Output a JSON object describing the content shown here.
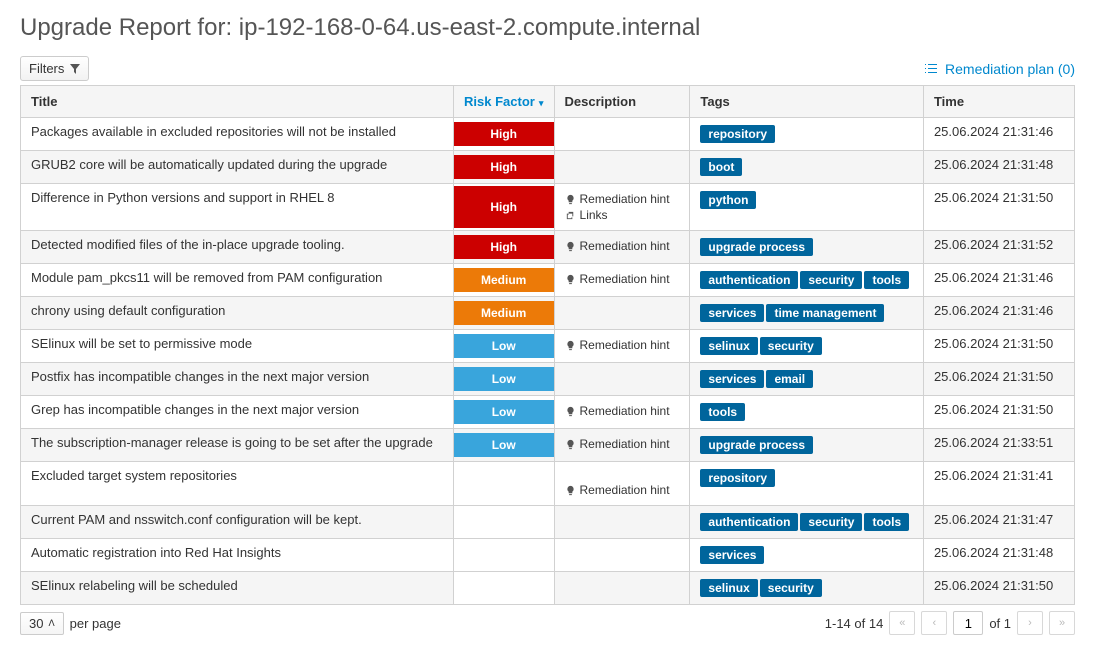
{
  "title": "Upgrade Report for: ip-192-168-0-64.us-east-2.compute.internal",
  "toolbar": {
    "filters_label": "Filters",
    "remediation_label": "Remediation plan (0)"
  },
  "columns": {
    "title": "Title",
    "risk": "Risk Factor",
    "desc": "Description",
    "tags": "Tags",
    "time": "Time"
  },
  "desc_text": {
    "hint": "Remediation hint",
    "links": "Links"
  },
  "rows": [
    {
      "title": "Packages available in excluded repositories will not be installed",
      "risk": "High",
      "hint": false,
      "links": false,
      "tags": [
        "repository"
      ],
      "time": "25.06.2024 21:31:46"
    },
    {
      "title": "GRUB2 core will be automatically updated during the upgrade",
      "risk": "High",
      "hint": false,
      "links": false,
      "tags": [
        "boot"
      ],
      "time": "25.06.2024 21:31:48"
    },
    {
      "title": "Difference in Python versions and support in RHEL 8",
      "risk": "High",
      "hint": true,
      "links": true,
      "tags": [
        "python"
      ],
      "time": "25.06.2024 21:31:50"
    },
    {
      "title": "Detected modified files of the in-place upgrade tooling.",
      "risk": "High",
      "hint": true,
      "links": false,
      "tags": [
        "upgrade process"
      ],
      "time": "25.06.2024 21:31:52"
    },
    {
      "title": "Module pam_pkcs11 will be removed from PAM configuration",
      "risk": "Medium",
      "hint": true,
      "links": false,
      "tags": [
        "authentication",
        "security",
        "tools"
      ],
      "time": "25.06.2024 21:31:46"
    },
    {
      "title": "chrony using default configuration",
      "risk": "Medium",
      "hint": false,
      "links": false,
      "tags": [
        "services",
        "time management"
      ],
      "time": "25.06.2024 21:31:46"
    },
    {
      "title": "SElinux will be set to permissive mode",
      "risk": "Low",
      "hint": true,
      "links": false,
      "tags": [
        "selinux",
        "security"
      ],
      "time": "25.06.2024 21:31:50"
    },
    {
      "title": "Postfix has incompatible changes in the next major version",
      "risk": "Low",
      "hint": false,
      "links": false,
      "tags": [
        "services",
        "email"
      ],
      "time": "25.06.2024 21:31:50"
    },
    {
      "title": "Grep has incompatible changes in the next major version",
      "risk": "Low",
      "hint": true,
      "links": false,
      "tags": [
        "tools"
      ],
      "time": "25.06.2024 21:31:50"
    },
    {
      "title": "The subscription-manager release is going to be set after the upgrade",
      "risk": "Low",
      "hint": true,
      "links": false,
      "tags": [
        "upgrade process"
      ],
      "time": "25.06.2024 21:33:51"
    },
    {
      "title": "Excluded target system repositories",
      "risk": "",
      "hint": true,
      "links": false,
      "tags": [
        "repository"
      ],
      "time": "25.06.2024 21:31:41",
      "tall": true
    },
    {
      "title": "Current PAM and nsswitch.conf configuration will be kept.",
      "risk": "",
      "hint": false,
      "links": false,
      "tags": [
        "authentication",
        "security",
        "tools"
      ],
      "time": "25.06.2024 21:31:47"
    },
    {
      "title": "Automatic registration into Red Hat Insights",
      "risk": "",
      "hint": false,
      "links": false,
      "tags": [
        "services"
      ],
      "time": "25.06.2024 21:31:48"
    },
    {
      "title": "SElinux relabeling will be scheduled",
      "risk": "",
      "hint": false,
      "links": false,
      "tags": [
        "selinux",
        "security"
      ],
      "time": "25.06.2024 21:31:50"
    }
  ],
  "footer": {
    "per_page_value": "30",
    "per_page_label": "per page",
    "range": "1-14 of 14",
    "page_current": "1",
    "of_label": "of 1"
  }
}
